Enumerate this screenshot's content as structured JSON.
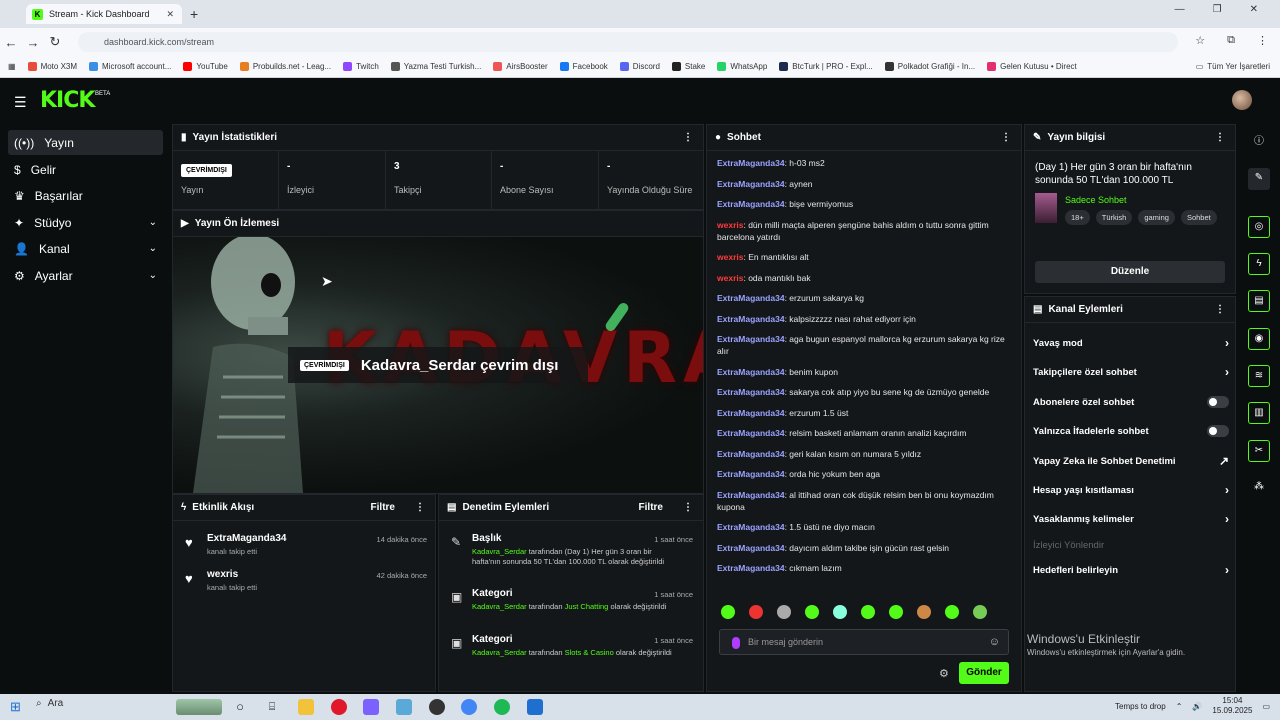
{
  "browser": {
    "tab_title": "Stream - Kick Dashboard",
    "url": "dashboard.kick.com/stream",
    "bookmarks": [
      "Moto X3M",
      "Microsoft account...",
      "YouTube",
      "Probuilds.net - Leag...",
      "Twitch",
      "Yazma Testi Turkish...",
      "AirsBooster",
      "Facebook",
      "Discord",
      "Stake",
      "WhatsApp",
      "BtcTurk | PRO - Expl...",
      "Polkadot Grafiği - In...",
      "Gelen Kutusu • Direct"
    ],
    "bookmarks_folder": "Tüm Yer İşaretleri"
  },
  "kick": {
    "logo": "KICK",
    "beta": "BETA"
  },
  "sidebar": {
    "items": [
      {
        "label": "Yayın",
        "icon": "broadcast-icon"
      },
      {
        "label": "Gelir",
        "icon": "dollar-icon"
      },
      {
        "label": "Başarılar",
        "icon": "trophy-icon"
      },
      {
        "label": "Stüdyo",
        "icon": "studio-icon"
      },
      {
        "label": "Kanal",
        "icon": "user-icon"
      },
      {
        "label": "Ayarlar",
        "icon": "gear-icon"
      }
    ]
  },
  "stats": {
    "title": "Yayın İstatistikleri",
    "status_badge": "ÇEVRİMDIŞI",
    "items": [
      {
        "label": "Yayın",
        "value": ""
      },
      {
        "label": "İzleyici",
        "value": "-"
      },
      {
        "label": "Takipçi",
        "value": "3"
      },
      {
        "label": "Abone Sayısı",
        "value": "-"
      },
      {
        "label": "Yayında Olduğu Süre",
        "value": "-"
      }
    ]
  },
  "preview": {
    "title": "Yayın Ön İzlemesi",
    "banner_text": "KADAVRA",
    "overlay_badge": "ÇEVRİMDIŞI",
    "overlay_text": "Kadavra_Serdar çevrim dışı"
  },
  "events": {
    "title": "Etkinlik Akışı",
    "filter": "Filtre",
    "items": [
      {
        "name": "ExtraMaganda34",
        "sub": "kanalı takip etti",
        "time": "14 dakika önce"
      },
      {
        "name": "wexris",
        "sub": "kanalı takip etti",
        "time": "42 dakika önce"
      }
    ]
  },
  "audit": {
    "title": "Denetim Eylemleri",
    "filter": "Filtre",
    "items": [
      {
        "name": "Başlık",
        "time": "1 saat önce",
        "user": "Kadavra_Serdar",
        "pre": " tarafından ",
        "value": "(Day 1) Her gün 3 oran bir hafta'nın sonunda 50 TL'dan 100.000 TL",
        "post": " olarak değiştirildi",
        "value_green": false
      },
      {
        "name": "Kategori",
        "time": "1 saat önce",
        "user": "Kadavra_Serdar",
        "pre": " tarafından ",
        "value": "Just Chatting",
        "post": " olarak değiştirildi",
        "value_green": true
      },
      {
        "name": "Kategori",
        "time": "1 saat önce",
        "user": "Kadavra_Serdar",
        "pre": " tarafından ",
        "value": "Slots & Casino",
        "post": " olarak değiştirildi",
        "value_green": true
      }
    ]
  },
  "chat": {
    "title": "Sohbet",
    "messages": [
      {
        "user": "ExtraMaganda34",
        "text": "h-03 ms2",
        "u": 1
      },
      {
        "user": "ExtraMaganda34",
        "text": "aynen",
        "u": 1
      },
      {
        "user": "ExtraMaganda34",
        "text": "bişe vermiyomus",
        "u": 1
      },
      {
        "user": "wexris",
        "text": "dün milli maçta alperen şengüne bahis aldım o tuttu sonra gittim barcelona yatırdı",
        "u": 2
      },
      {
        "user": "wexris",
        "text": "En mantıklısı alt",
        "u": 2
      },
      {
        "user": "wexris",
        "text": "oda mantıklı bak",
        "u": 2
      },
      {
        "user": "ExtraMaganda34",
        "text": "erzurum sakarya kg",
        "u": 1
      },
      {
        "user": "ExtraMaganda34",
        "text": "kalpsizzzzz nası rahat ediyorr için",
        "u": 1
      },
      {
        "user": "ExtraMaganda34",
        "text": "aga bugun espanyol mallorca kg erzurum sakarya kg rize alır",
        "u": 1
      },
      {
        "user": "ExtraMaganda34",
        "text": "benim kupon",
        "u": 1
      },
      {
        "user": "ExtraMaganda34",
        "text": "sakarya cok atıp yiyo bu sene kg de üzmüyo genelde",
        "u": 1
      },
      {
        "user": "ExtraMaganda34",
        "text": "erzurum 1.5 üst",
        "u": 1
      },
      {
        "user": "ExtraMaganda34",
        "text": "relsim basketi anlamam oranın analizi kaçırdım",
        "u": 1
      },
      {
        "user": "ExtraMaganda34",
        "text": "geri kalan kısım on numara 5 yıldız",
        "u": 1
      },
      {
        "user": "ExtraMaganda34",
        "text": "orda hic yokum ben aga",
        "u": 1
      },
      {
        "user": "ExtraMaganda34",
        "text": "al ittihad oran cok düşük relsim ben bi onu koymazdım kupona",
        "u": 1
      },
      {
        "user": "ExtraMaganda34",
        "text": "1.5 üstü ne diyo macın",
        "u": 1
      },
      {
        "user": "ExtraMaganda34",
        "text": "dayıcım aldım takibe işin gücün rast gelsin",
        "u": 1
      },
      {
        "user": "ExtraMaganda34",
        "text": "cıkmam lazım",
        "u": 1
      }
    ],
    "placeholder": "Bir mesaj gönderin",
    "send": "Gönder"
  },
  "info": {
    "title": "Yayın bilgisi",
    "stream_title": "(Day 1) Her gün 3 oran bir hafta'nın sonunda 50 TL'dan 100.000 TL",
    "category": "Sadece Sohbet",
    "tags": [
      "18+",
      "Türkish",
      "gaming",
      "Sohbet"
    ],
    "edit": "Düzenle"
  },
  "actions": {
    "title": "Kanal Eylemleri",
    "items": [
      {
        "label": "Yavaş mod",
        "kind": "arrow"
      },
      {
        "label": "Takipçilere özel sohbet",
        "kind": "arrow"
      },
      {
        "label": "Abonelere özel sohbet",
        "kind": "toggle"
      },
      {
        "label": "Yalnızca İfadelerle sohbet",
        "kind": "toggle"
      },
      {
        "label": "Yapay Zeka ile Sohbet Denetimi",
        "kind": "external"
      },
      {
        "label": "Hesap yaşı kısıtlaması",
        "kind": "arrow"
      },
      {
        "label": "Yasaklanmış kelimeler",
        "kind": "arrow"
      },
      {
        "label": "İzleyici Yönlendir",
        "kind": "disabled"
      },
      {
        "label": "Hedefleri belirleyin",
        "kind": "arrow"
      }
    ]
  },
  "activation": {
    "line1": "Windows'u Etkinleştir",
    "line2": "Windows'u etkinleştirmek için Ayarlar'a gidin."
  },
  "taskbar": {
    "search": "Ara",
    "weather": "Temps to drop",
    "time": "15:04",
    "date": "15.09.2025"
  }
}
